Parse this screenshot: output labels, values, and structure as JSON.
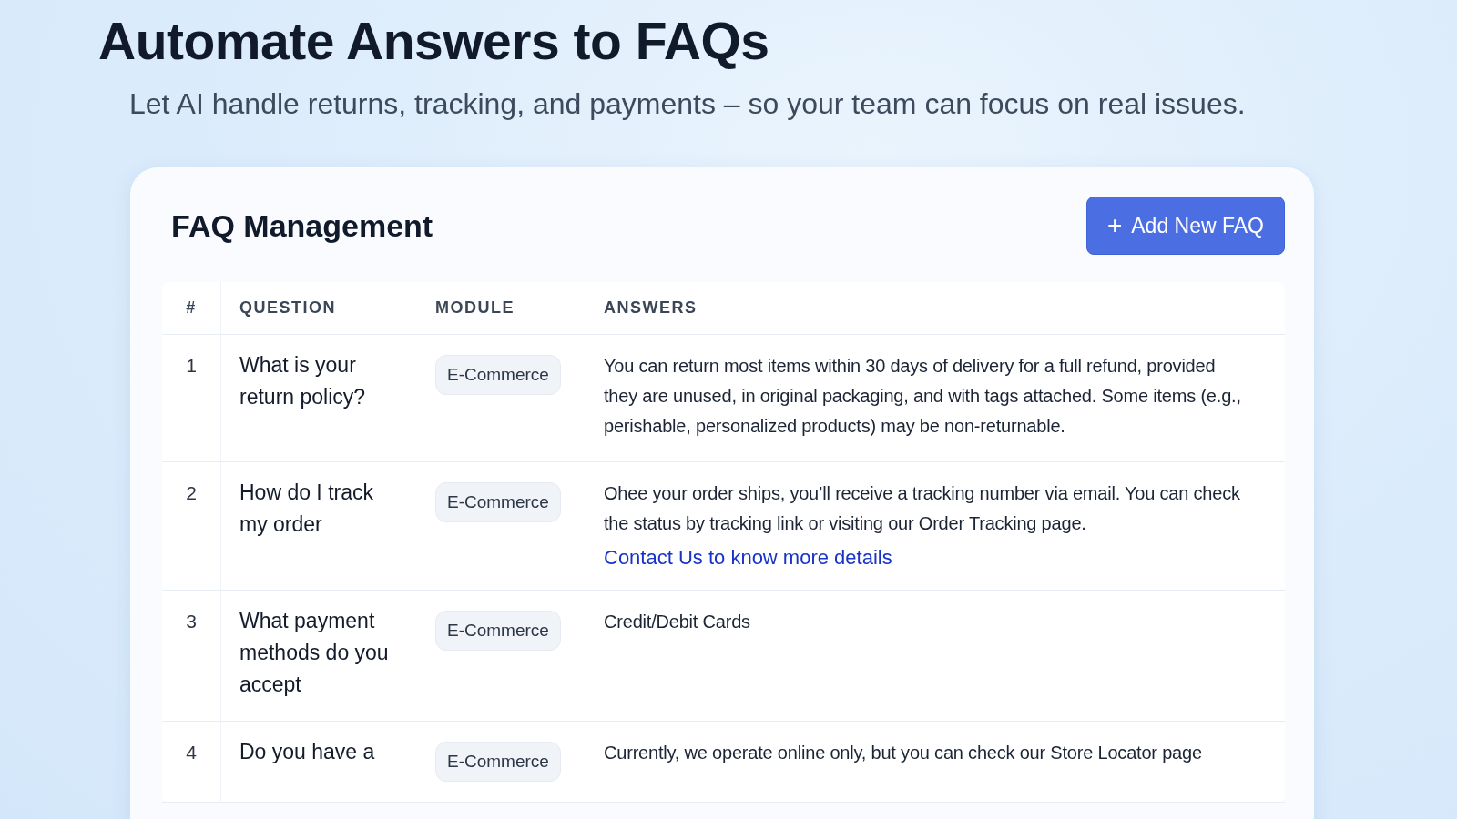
{
  "hero": {
    "title": "Automate Answers to FAQs",
    "subtitle": "Let AI handle returns, tracking, and payments – so your team can focus on real issues."
  },
  "panel": {
    "title": "FAQ Management",
    "add_button": {
      "icon": "+",
      "label": "Add New FAQ"
    }
  },
  "table": {
    "columns": [
      "#",
      "QUESTION",
      "MODULE",
      "ANSWERS"
    ],
    "rows": [
      {
        "number": "1",
        "question": "What is your return policy?",
        "module": "E-Commerce",
        "answer": "You can return most items within 30 days of delivery for a full refund, provided they are unused, in original packaging, and with tags attached. Some items (e.g., perishable, personalized products) may be non-returnable."
      },
      {
        "number": "2",
        "question": "How do I track my order",
        "module": "E-Commerce",
        "answer": "Ohee your order ships, you’ll receive a tracking number via email. You can check the status by tracking link or visiting our Order Tracking page.",
        "link": "Contact Us to know more details"
      },
      {
        "number": "3",
        "question": "What payment methods do you accept",
        "module": "E-Commerce",
        "answer": "Credit/Debit Cards"
      },
      {
        "number": "4",
        "question": "Do you have a",
        "module": "E-Commerce",
        "answer": "Currently, we operate online only, but you can check our Store Locator page"
      }
    ]
  }
}
